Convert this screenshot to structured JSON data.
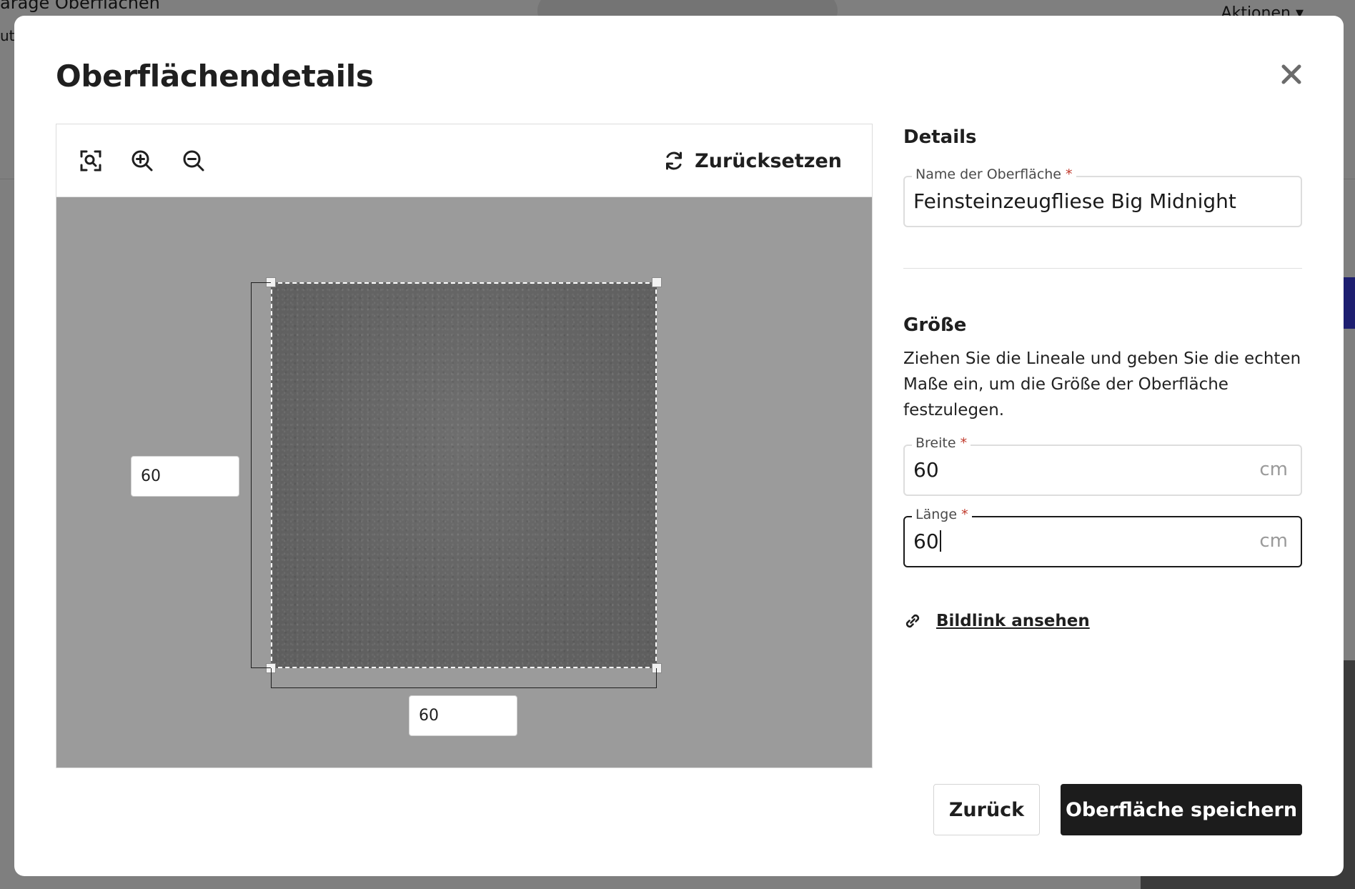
{
  "background": {
    "title": "arage Oberflächen",
    "sub": "ut",
    "actions_label": "Aktionen"
  },
  "modal": {
    "title": "Oberflächendetails",
    "close_icon": "close-icon"
  },
  "editor": {
    "tools": [
      {
        "icon": "zoom-fit-icon"
      },
      {
        "icon": "zoom-in-icon"
      },
      {
        "icon": "zoom-out-icon"
      }
    ],
    "reset_label": "Zurücksetzen",
    "reset_icon": "refresh-icon",
    "height_input_value": "60",
    "width_input_value": "60"
  },
  "details": {
    "heading": "Details",
    "name_label": "Name der Oberfläche",
    "name_value": "Feinsteinzeugfliese Big Midnight",
    "required_mark": "*"
  },
  "size": {
    "heading": "Größe",
    "description": "Ziehen Sie die Lineale und geben Sie die echten Maße ein, um die Größe der Oberfläche festzulegen.",
    "width_label": "Breite",
    "width_value": "60",
    "length_label": "Länge",
    "length_value": "60",
    "unit": "cm"
  },
  "link": {
    "label": "Bildlink ansehen",
    "icon": "link-icon"
  },
  "footer": {
    "back_label": "Zurück",
    "save_label": "Oberfläche speichern"
  },
  "colors": {
    "primary": "#1c1c1c",
    "required": "#c0392b",
    "canvas": "#9b9b9b"
  }
}
